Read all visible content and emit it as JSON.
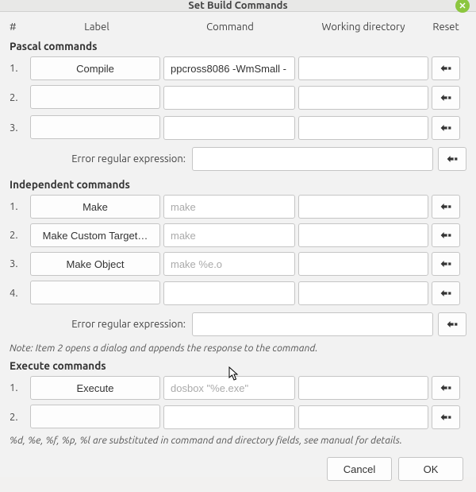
{
  "title": "Set Build Commands",
  "headers": {
    "num": "#",
    "label": "Label",
    "command": "Command",
    "working_dir": "Working directory",
    "reset": "Reset"
  },
  "pascal": {
    "title": "Pascal commands",
    "rows": [
      {
        "n": "1.",
        "label": "Compile",
        "cmd": "ppcross8086 -WmSmall -",
        "wd": ""
      },
      {
        "n": "2.",
        "label": "",
        "cmd": "",
        "wd": ""
      },
      {
        "n": "3.",
        "label": "",
        "cmd": "",
        "wd": ""
      }
    ],
    "err_label": "Error regular expression:",
    "err_value": ""
  },
  "independent": {
    "title": "Independent commands",
    "rows": [
      {
        "n": "1.",
        "label": "Make",
        "cmd_ph": "make",
        "cmd": "",
        "wd": ""
      },
      {
        "n": "2.",
        "label": "Make Custom Target…",
        "cmd_ph": "make",
        "cmd": "",
        "wd": ""
      },
      {
        "n": "3.",
        "label": "Make Object",
        "cmd_ph": "make %e.o",
        "cmd": "",
        "wd": ""
      },
      {
        "n": "4.",
        "label": "",
        "cmd_ph": "",
        "cmd": "",
        "wd": ""
      }
    ],
    "err_label": "Error regular expression:",
    "err_value": ""
  },
  "note_independent": "Note: Item 2 opens a dialog and appends the response to the command.",
  "execute": {
    "title": "Execute commands",
    "rows": [
      {
        "n": "1.",
        "label": "Execute",
        "cmd_ph": "dosbox \"%e.exe\"",
        "cmd": "",
        "wd": ""
      },
      {
        "n": "2.",
        "label": "",
        "cmd_ph": "",
        "cmd": "",
        "wd": ""
      }
    ]
  },
  "substitution_note": "%d, %e, %f, %p, %l are substituted in command and directory fields, see manual for details.",
  "buttons": {
    "cancel": "Cancel",
    "ok": "OK"
  }
}
